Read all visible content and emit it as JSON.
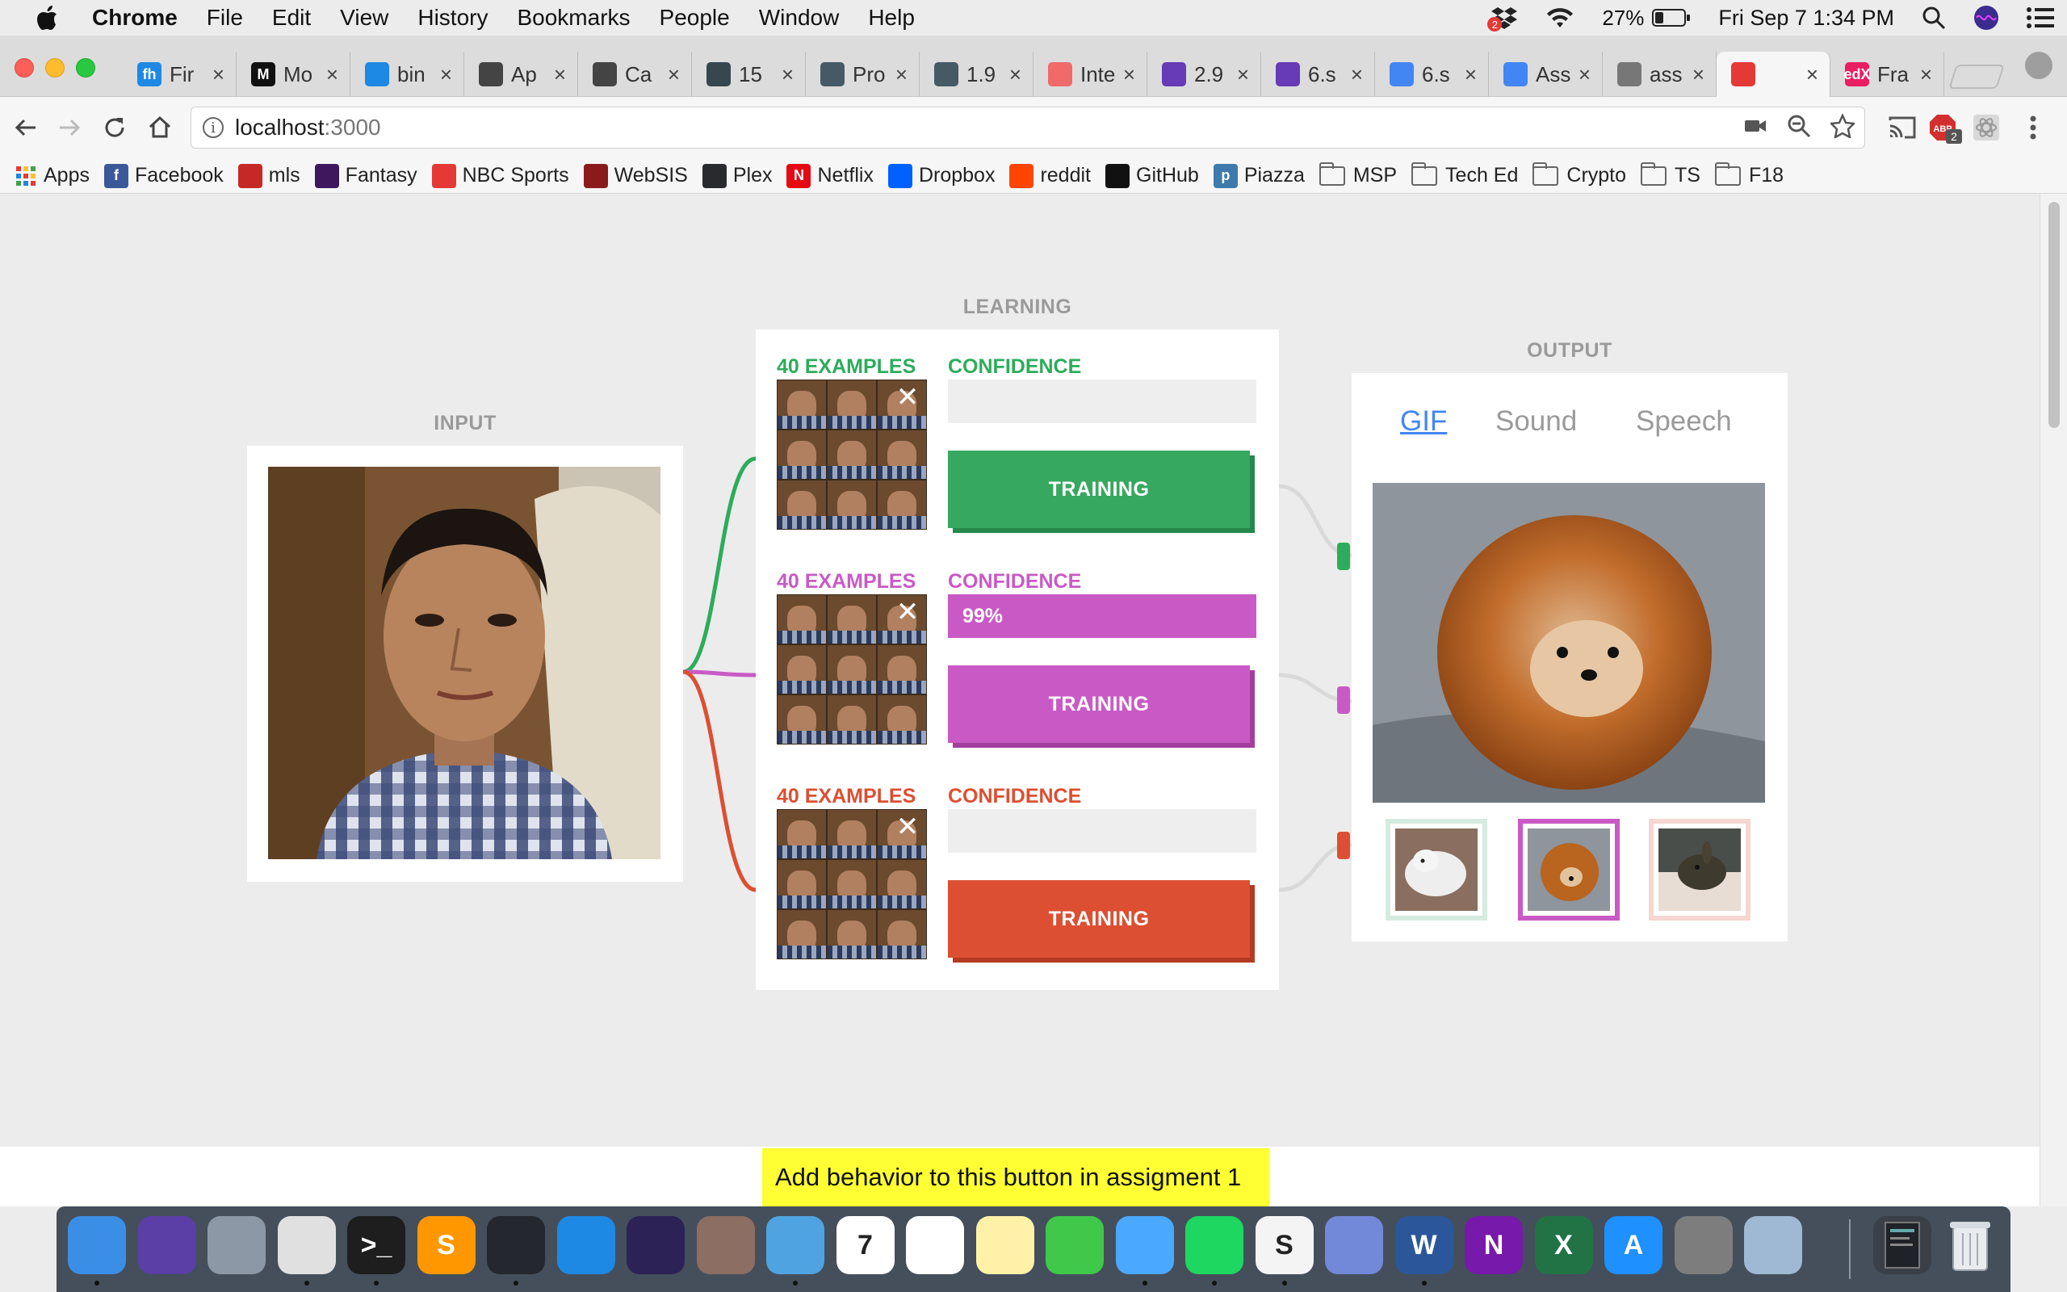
{
  "menubar": {
    "app": "Chrome",
    "items": [
      "File",
      "Edit",
      "View",
      "History",
      "Bookmarks",
      "People",
      "Window",
      "Help"
    ],
    "battery": "27%",
    "clock": "Fri Sep 7  1:34 PM",
    "dropbox_badge": "2"
  },
  "tabs": [
    {
      "title": "Fir",
      "favicon": "fh",
      "color": "#1e88e5"
    },
    {
      "title": "Mo",
      "favicon": "M",
      "color": "#111111"
    },
    {
      "title": "bin",
      "favicon": "",
      "color": "#1e88e5"
    },
    {
      "title": "Ap",
      "favicon": "",
      "color": "#444444"
    },
    {
      "title": "Ca",
      "favicon": "",
      "color": "#444444"
    },
    {
      "title": "15",
      "favicon": "",
      "color": "#37474f"
    },
    {
      "title": "Pro",
      "favicon": "",
      "color": "#455a64"
    },
    {
      "title": "1.9",
      "favicon": "",
      "color": "#455a64"
    },
    {
      "title": "Inte",
      "favicon": "",
      "color": "#f06a6a"
    },
    {
      "title": "2.9",
      "favicon": "",
      "color": "#673ab7"
    },
    {
      "title": "6.s",
      "favicon": "",
      "color": "#673ab7"
    },
    {
      "title": "6.s",
      "favicon": "",
      "color": "#4285f4"
    },
    {
      "title": "Ass",
      "favicon": "",
      "color": "#4285f4"
    },
    {
      "title": "ass",
      "favicon": "",
      "color": "#777777"
    },
    {
      "title": "",
      "favicon": "",
      "color": "#e53935",
      "active": true
    },
    {
      "title": "Fra",
      "favicon": "edX",
      "color": "#e91e63"
    }
  ],
  "toolbar": {
    "url_host": "localhost",
    "url_port": ":3000",
    "abp_badge": "2"
  },
  "bookmarks": [
    {
      "label": "Apps",
      "type": "apps",
      "color": "#e53935"
    },
    {
      "label": "Facebook",
      "type": "site",
      "icon": "f",
      "color": "#3b5998"
    },
    {
      "label": "mls",
      "type": "site",
      "icon": "",
      "color": "#c62828"
    },
    {
      "label": "Fantasy",
      "type": "site",
      "icon": "",
      "color": "#3d185c"
    },
    {
      "label": "NBC Sports",
      "type": "site",
      "icon": "",
      "color": "#e53935"
    },
    {
      "label": "WebSIS",
      "type": "site",
      "icon": "",
      "color": "#8b1a1a"
    },
    {
      "label": "Plex",
      "type": "site",
      "icon": "",
      "color": "#282a2d"
    },
    {
      "label": "Netflix",
      "type": "site",
      "icon": "N",
      "color": "#e50914"
    },
    {
      "label": "Dropbox",
      "type": "site",
      "icon": "",
      "color": "#0061ff"
    },
    {
      "label": "reddit",
      "type": "site",
      "icon": "",
      "color": "#ff4500"
    },
    {
      "label": "GitHub",
      "type": "site",
      "icon": "",
      "color": "#111111"
    },
    {
      "label": "Piazza",
      "type": "site",
      "icon": "p",
      "color": "#3e7aab"
    },
    {
      "label": "MSP",
      "type": "folder"
    },
    {
      "label": "Tech Ed",
      "type": "folder"
    },
    {
      "label": "Crypto",
      "type": "folder"
    },
    {
      "label": "TS",
      "type": "folder"
    },
    {
      "label": "F18",
      "type": "folder"
    }
  ],
  "app": {
    "input_label": "INPUT",
    "learning_label": "LEARNING",
    "output_label": "OUTPUT",
    "classes": [
      {
        "examples": "40 EXAMPLES",
        "confidence_label": "CONFIDENCE",
        "confidence": 0,
        "confidence_text": "",
        "button": "TRAINING",
        "color": "#2dac5c",
        "button_color": "#37a85f",
        "shadow": "#24894a"
      },
      {
        "examples": "40 EXAMPLES",
        "confidence_label": "CONFIDENCE",
        "confidence": 1,
        "confidence_text": "99%",
        "button": "TRAINING",
        "color": "#c95ac5",
        "button_color": "#c95ac5",
        "shadow": "#a23f9e"
      },
      {
        "examples": "40 EXAMPLES",
        "confidence_label": "CONFIDENCE",
        "confidence": 0,
        "confidence_text": "",
        "button": "TRAINING",
        "color": "#dc4f32",
        "button_color": "#dc4f32",
        "shadow": "#b43a22"
      }
    ],
    "output_tabs": [
      "GIF",
      "Sound",
      "Speech"
    ],
    "selected_output_tab": "GIF",
    "tooltip": "Add behavior to this button in assigment 1"
  },
  "dock": [
    {
      "name": "finder",
      "color": "#3a8ee6",
      "label": "",
      "running": true
    },
    {
      "name": "siri",
      "color": "#5b3fa6",
      "label": "",
      "running": false
    },
    {
      "name": "launchpad",
      "color": "#8c98a6",
      "label": "",
      "running": false
    },
    {
      "name": "chrome",
      "color": "#e0e0e0",
      "label": "",
      "running": true
    },
    {
      "name": "terminal",
      "color": "#1e1e1e",
      "label": ">_",
      "running": true
    },
    {
      "name": "sublime",
      "color": "#ff9800",
      "label": "S",
      "running": false
    },
    {
      "name": "vscode",
      "color": "#24282e",
      "label": "",
      "running": true
    },
    {
      "name": "xcode",
      "color": "#1e88e5",
      "label": "",
      "running": false
    },
    {
      "name": "eclipse",
      "color": "#2c2255",
      "label": "",
      "running": false
    },
    {
      "name": "animal",
      "color": "#8d6e63",
      "label": "",
      "running": false
    },
    {
      "name": "mail",
      "color": "#4fa3e0",
      "label": "",
      "running": true
    },
    {
      "name": "calendar",
      "color": "#ffffff",
      "label": "7",
      "running": false
    },
    {
      "name": "photos",
      "color": "#ffffff",
      "label": "",
      "running": false
    },
    {
      "name": "notes",
      "color": "#fff2a8",
      "label": "",
      "running": false
    },
    {
      "name": "facetime",
      "color": "#3fc84a",
      "label": "",
      "running": false
    },
    {
      "name": "messages",
      "color": "#4aa8ff",
      "label": "",
      "running": true
    },
    {
      "name": "spotify",
      "color": "#1ed760",
      "label": "",
      "running": true
    },
    {
      "name": "slack",
      "color": "#f4f4f4",
      "label": "S",
      "running": true
    },
    {
      "name": "discord",
      "color": "#7289da",
      "label": "",
      "running": false
    },
    {
      "name": "word",
      "color": "#2b579a",
      "label": "W",
      "running": true
    },
    {
      "name": "onenote",
      "color": "#7719aa",
      "label": "N",
      "running": false
    },
    {
      "name": "excel",
      "color": "#217346",
      "label": "X",
      "running": false
    },
    {
      "name": "appstore",
      "color": "#1e90ff",
      "label": "A",
      "running": false
    },
    {
      "name": "settings",
      "color": "#7d7d7d",
      "label": "",
      "running": false
    },
    {
      "name": "preview",
      "color": "#9fb8d3",
      "label": "",
      "running": false
    }
  ]
}
